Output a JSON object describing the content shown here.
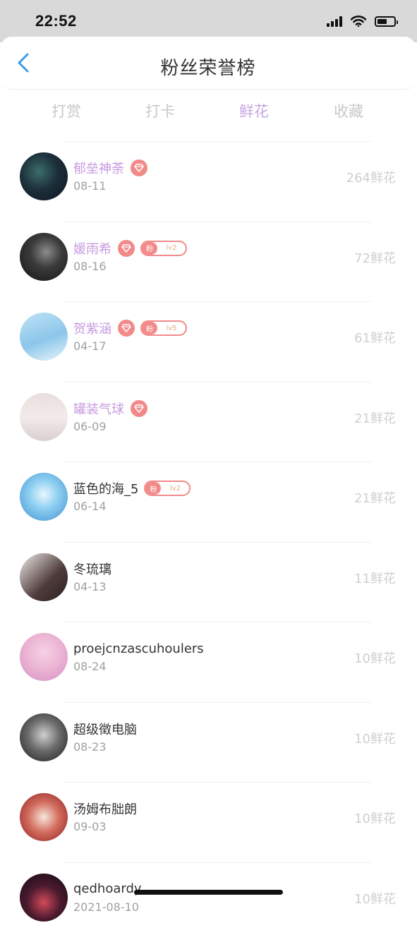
{
  "status": {
    "time": "22:52",
    "battery_level": 0.6
  },
  "header": {
    "title": "粉丝荣誉榜",
    "back_icon": "chevron-left-icon"
  },
  "tabs": [
    {
      "label": "打赏",
      "active": false
    },
    {
      "label": "打卡",
      "active": false
    },
    {
      "label": "鲜花",
      "active": true
    },
    {
      "label": "收藏",
      "active": false
    }
  ],
  "colors": {
    "active_tab": "#c8a6e2",
    "vip_name": "#c89ae0",
    "badge": "#f28a8a",
    "count_text": "#cfcfcf"
  },
  "list": [
    {
      "name": "郁垒神荼",
      "date": "08-11",
      "count": "264鲜花",
      "vip": true,
      "diamond": true,
      "fan_badge": null
    },
    {
      "name": "媛雨希",
      "date": "08-16",
      "count": "72鲜花",
      "vip": true,
      "diamond": true,
      "fan_badge": {
        "label": "粉",
        "level": "lv2"
      }
    },
    {
      "name": "贺紫涵",
      "date": "04-17",
      "count": "61鲜花",
      "vip": true,
      "diamond": true,
      "fan_badge": {
        "label": "粉",
        "level": "lv5"
      }
    },
    {
      "name": "罐装气球",
      "date": "06-09",
      "count": "21鲜花",
      "vip": true,
      "diamond": true,
      "fan_badge": null
    },
    {
      "name": "蓝色的海_5",
      "date": "06-14",
      "count": "21鲜花",
      "vip": false,
      "diamond": false,
      "fan_badge": {
        "label": "粉",
        "level": "lv2"
      }
    },
    {
      "name": "冬琉璃",
      "date": "04-13",
      "count": "11鲜花",
      "vip": false,
      "diamond": false,
      "fan_badge": null
    },
    {
      "name": "proejcnzascuhoulers",
      "date": "08-24",
      "count": "10鲜花",
      "vip": false,
      "diamond": false,
      "fan_badge": null
    },
    {
      "name": "超级徵电脑",
      "date": "08-23",
      "count": "10鲜花",
      "vip": false,
      "diamond": false,
      "fan_badge": null
    },
    {
      "name": "汤姆布朏朗",
      "date": "09-03",
      "count": "10鲜花",
      "vip": false,
      "diamond": false,
      "fan_badge": null
    },
    {
      "name": "qedhoardy",
      "date": "2021-08-10",
      "count": "10鲜花",
      "vip": false,
      "diamond": false,
      "fan_badge": null
    }
  ]
}
